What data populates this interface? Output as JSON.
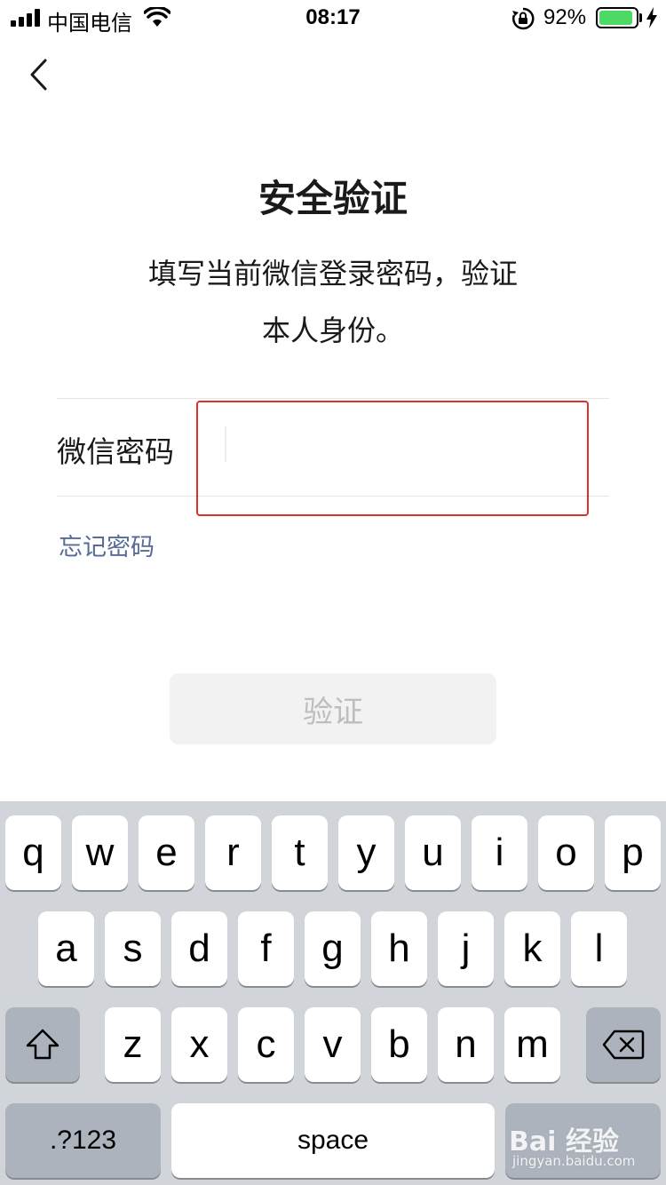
{
  "status_bar": {
    "carrier": "中国电信",
    "time": "08:17",
    "battery_percent": "92%",
    "battery_level": 0.92,
    "icons": [
      "signal-icon",
      "wifi-icon",
      "rotation-lock-icon",
      "battery-icon",
      "charging-bolt-icon"
    ]
  },
  "nav": {
    "back_icon": "chevron-left-icon"
  },
  "main": {
    "title": "安全验证",
    "description_line1": "填写当前微信登录密码，验证",
    "description_line2": "本人身份。",
    "field_label": "微信密码",
    "password_value": "",
    "forgot_password": "忘记密码",
    "verify_button": "验证",
    "highlight_color": "#e0302d",
    "link_color": "#576b95"
  },
  "keyboard": {
    "row1": [
      "q",
      "w",
      "e",
      "r",
      "t",
      "y",
      "u",
      "i",
      "o",
      "p"
    ],
    "row2": [
      "a",
      "s",
      "d",
      "f",
      "g",
      "h",
      "j",
      "k",
      "l"
    ],
    "row3": [
      "z",
      "x",
      "c",
      "v",
      "b",
      "n",
      "m"
    ],
    "shift_icon": "shift-icon",
    "delete_icon": "backspace-icon",
    "numbers_label": ".?123",
    "space_label": "space"
  },
  "watermark": {
    "text": "Bai 经验",
    "subtext": "jingyan.baidu.com"
  }
}
